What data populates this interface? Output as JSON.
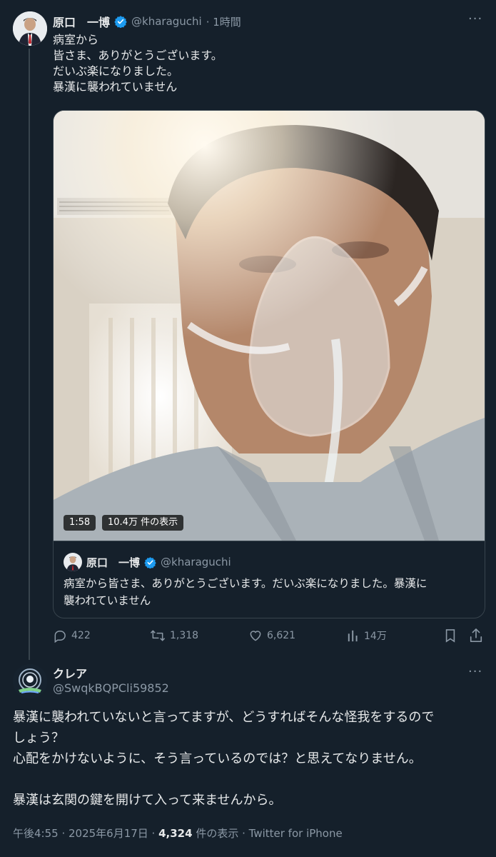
{
  "main_tweet": {
    "author_name": "原口　一博",
    "handle": "@kharaguchi",
    "time": "· 1時間",
    "more_label": "···",
    "text_lines": [
      "病室から",
      "皆さま、ありがとうございます。",
      "だいぶ楽になりました。",
      "暴漢に襲われていません"
    ],
    "video": {
      "duration": "1:58",
      "views": "10.4万 件の表示"
    },
    "quoted": {
      "author_name": "原口　一博",
      "handle": "@kharaguchi",
      "text_lines": [
        "病室から皆さま、ありがとうございます。だいぶ楽になりました。暴漢に",
        "襲われていません"
      ]
    },
    "actions": {
      "replies": "422",
      "retweets": "1,318",
      "likes": "6,621",
      "views": "14万"
    }
  },
  "reply_tweet": {
    "author_name": "クレア",
    "handle": "@SwqkBQPCli59852",
    "more_label": "···",
    "text_lines": [
      "暴漢に襲われていないと言ってますが、どうすればそんな怪我をするので",
      "しょう？",
      "心配をかけないように、そう言っているのでは？と思えてなりません。",
      "",
      "暴漢は玄関の鍵を開けて入って来ませんから。"
    ],
    "footer": {
      "time": "午後4:55 · 2025年6月17日 · ",
      "views_count": "4,324",
      "views_label": " 件の表示 · Twitter for iPhone"
    }
  },
  "colors": {
    "background": "#15202b",
    "text": "#e7e9ea",
    "secondary": "#8b98a5",
    "border": "#38444d",
    "verified": "#1d9bf0"
  }
}
